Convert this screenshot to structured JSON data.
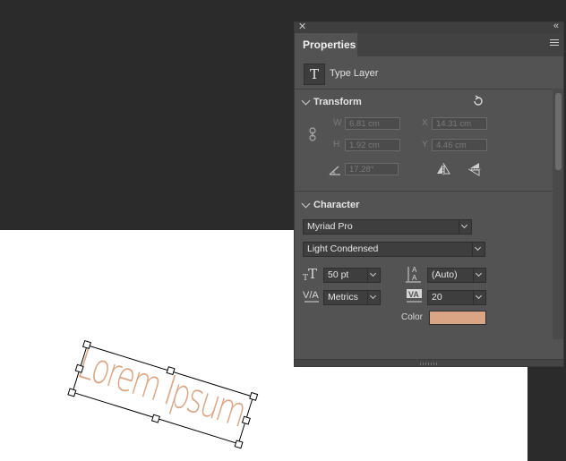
{
  "canvas": {
    "text": "Lorem Ipsum",
    "text_color": "#d9a787",
    "document_bg": "#ffffff"
  },
  "panel": {
    "tab_label": "Properties",
    "layer_kind_icon": "T",
    "layer_kind": "Type Layer",
    "transform": {
      "title": "Transform",
      "w_label": "W",
      "w_value": "6.81 cm",
      "x_label": "X",
      "x_value": "14.31 cm",
      "h_label": "H",
      "h_value": "1.92 cm",
      "y_label": "Y",
      "y_value": "4.46 cm",
      "angle_value": "17.28°"
    },
    "character": {
      "title": "Character",
      "font_family": "Myriad Pro",
      "font_style": "Light Condensed",
      "font_size": "50 pt",
      "leading": "(Auto)",
      "kerning": "Metrics",
      "tracking": "20",
      "color_label": "Color",
      "color_swatch": "#d9a585"
    },
    "icons": [
      "close-icon",
      "collapse-icon",
      "menu-icon",
      "link-icon",
      "reset-icon",
      "angle-icon",
      "flip-horizontal-icon",
      "flip-vertical-icon"
    ]
  }
}
